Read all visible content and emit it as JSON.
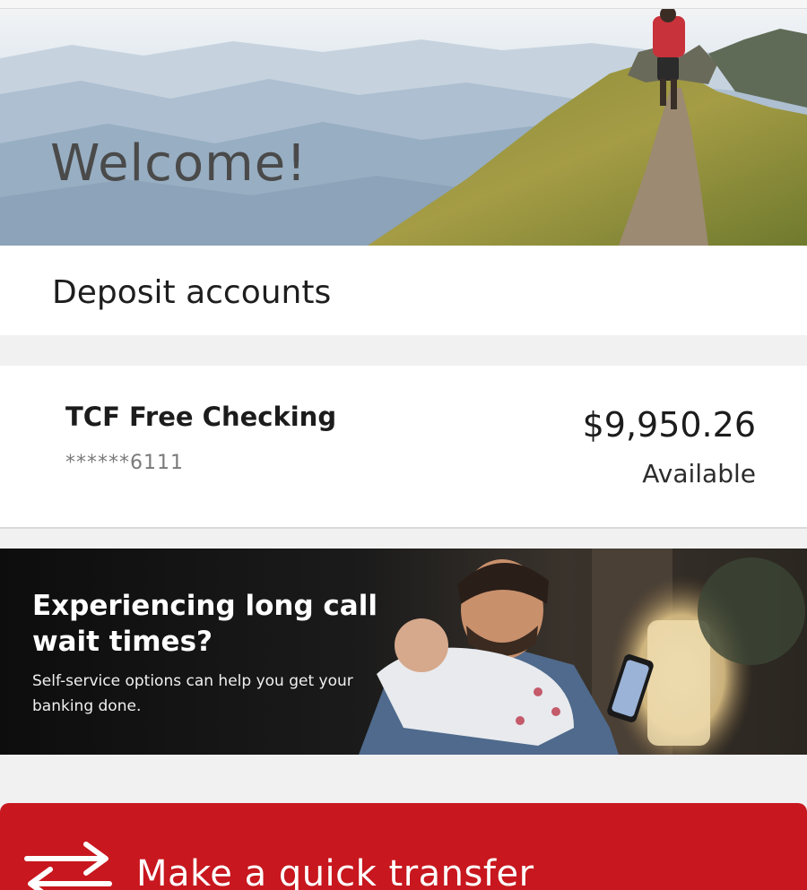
{
  "hero": {
    "title": "Welcome!"
  },
  "deposit_section": {
    "title": "Deposit accounts"
  },
  "accounts": [
    {
      "name": "TCF Free Checking",
      "masked_number": "******6111",
      "balance": "$9,950.26",
      "balance_label": "Available"
    }
  ],
  "promo": {
    "headline": "Experiencing long call wait times?",
    "body": "Self-service options can help you get your banking done."
  },
  "quick_transfer": {
    "label": "Make a quick transfer",
    "icon": "transfer-arrows-icon"
  },
  "colors": {
    "brand_red": "#c8171e",
    "page_bg": "#f1f1f1",
    "card_bg": "#ffffff"
  }
}
